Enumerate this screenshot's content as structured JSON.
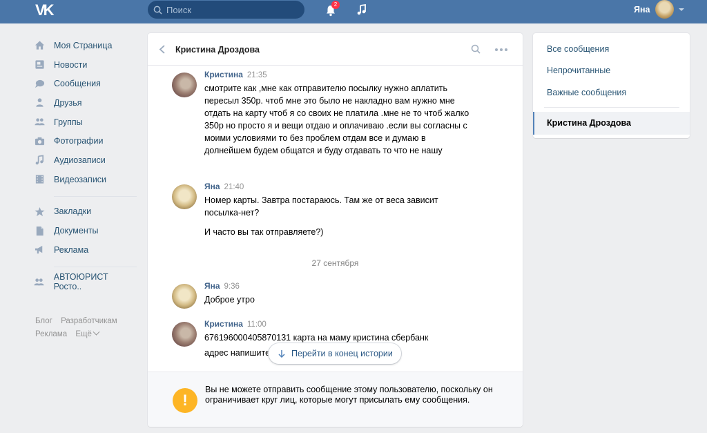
{
  "header": {
    "search_placeholder": "Поиск",
    "notifications_count": "2",
    "user_name": "Яна"
  },
  "nav": {
    "items": [
      {
        "label": "Моя Страница",
        "icon": "home-icon"
      },
      {
        "label": "Новости",
        "icon": "news-icon"
      },
      {
        "label": "Сообщения",
        "icon": "messages-icon"
      },
      {
        "label": "Друзья",
        "icon": "friends-icon"
      },
      {
        "label": "Группы",
        "icon": "groups-icon"
      },
      {
        "label": "Фотографии",
        "icon": "camera-icon"
      },
      {
        "label": "Аудиозаписи",
        "icon": "music-icon"
      },
      {
        "label": "Видеозаписи",
        "icon": "video-icon"
      },
      {
        "label": "Закладки",
        "icon": "star-icon"
      },
      {
        "label": "Документы",
        "icon": "document-icon"
      },
      {
        "label": "Реклама",
        "icon": "megaphone-icon"
      },
      {
        "label": "АВТОЮРИСТ Росто..",
        "icon": "group-icon"
      }
    ],
    "footer": {
      "blog": "Блог",
      "developers": "Разработчикам",
      "ads": "Реклама",
      "more": "Ещё"
    }
  },
  "chat": {
    "title": "Кристина Дроздова",
    "messages": [
      {
        "author": "Кристина",
        "time": "21:35",
        "text": "смотрите как ,мне как отправителю посылку нужно аплатить пересыл 350р. чтоб мне это было не накладно вам нужно мне отдать на карту чтоб я со своих не платила .мне не то чтоб жалко 350р но просто я и вещи отдаю и оплачиваю .если вы согласны с моими условиями то без проблем отдам все и думаю в долнейшем будем общатся и буду отдавать то что не нашу"
      },
      {
        "author": "Яна",
        "time": "21:40",
        "text": "Номер карты. Завтра постараюсь. Там же от веса зависит посылка-нет?",
        "text2": "И часто вы так отправляете?)"
      },
      {
        "author": "Яна",
        "time": "9:36",
        "text": "Доброе утро"
      },
      {
        "author": "Кристина",
        "time": "11:00",
        "text": "676196000405870131 карта на маму кристина сбербанк",
        "text2": "адрес напишите"
      }
    ],
    "date_separator": "27 сентября",
    "jump_button": "Перейти в конец истории",
    "notice": "Вы не можете отправить сообщение этому пользователю, поскольку он ограничивает круг лиц, которые могут присылать ему сообщения."
  },
  "right_panel": {
    "all_messages": "Все сообщения",
    "unread": "Непрочитанные",
    "important": "Важные сообщения",
    "active_dialog": "Кристина Дроздова"
  }
}
